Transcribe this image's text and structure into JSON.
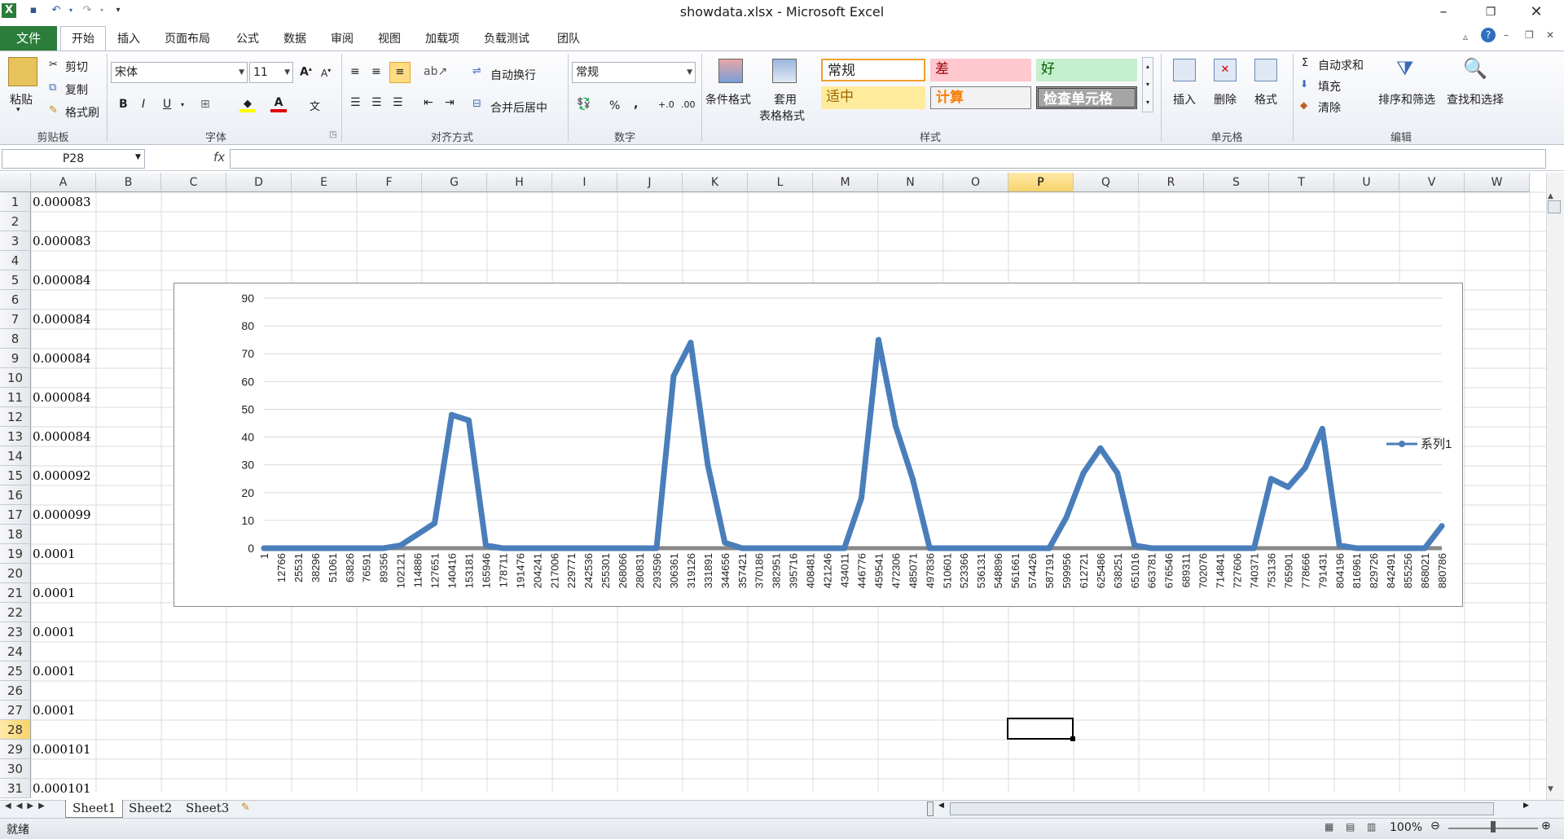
{
  "window": {
    "title": "showdata.xlsx - Microsoft Excel"
  },
  "tabs": {
    "file": "文件",
    "items": [
      "开始",
      "插入",
      "页面布局",
      "公式",
      "数据",
      "审阅",
      "视图",
      "加载项",
      "负载测试",
      "团队"
    ]
  },
  "ribbon": {
    "clipboard": {
      "paste": "粘贴",
      "cut": "剪切",
      "copy": "复制",
      "format_painter": "格式刷",
      "group": "剪贴板"
    },
    "font": {
      "name": "宋体",
      "size": "11",
      "bold": "B",
      "italic": "I",
      "underline": "U",
      "group": "字体"
    },
    "alignment": {
      "wrap": "自动换行",
      "merge": "合并后居中",
      "group": "对齐方式"
    },
    "number": {
      "format": "常规",
      "percent": "%",
      "comma": ",",
      "group": "数字"
    },
    "styles": {
      "cond_format": "条件格式",
      "table_format_1": "套用",
      "table_format_2": "表格格式",
      "normal": "常规",
      "bad": "差",
      "good": "好",
      "neutral": "适中",
      "calc": "计算",
      "check": "检查单元格",
      "group": "样式"
    },
    "cells": {
      "insert": "插入",
      "delete": "删除",
      "format": "格式",
      "group": "单元格"
    },
    "editing": {
      "autosum": "自动求和",
      "fill": "填充",
      "clear": "清除",
      "sort": "排序和筛选",
      "find": "查找和选择",
      "group": "编辑"
    }
  },
  "formula_bar": {
    "name_box": "P28",
    "fx": "fx",
    "value": ""
  },
  "columns": [
    "A",
    "B",
    "C",
    "D",
    "E",
    "F",
    "G",
    "H",
    "I",
    "J",
    "K",
    "L",
    "M",
    "N",
    "O",
    "P",
    "Q",
    "R",
    "S",
    "T",
    "U",
    "V",
    "W"
  ],
  "selected_column": "P",
  "selected_row": 28,
  "rows": [
    "1",
    "2",
    "3",
    "4",
    "5",
    "6",
    "7",
    "8",
    "9",
    "10",
    "11",
    "12",
    "13",
    "14",
    "15",
    "16",
    "17",
    "18",
    "19",
    "20",
    "21",
    "22",
    "23",
    "24",
    "25",
    "26",
    "27",
    "28",
    "29",
    "30",
    "31"
  ],
  "colA": [
    "0.000083",
    "",
    "0.000083",
    "",
    "0.000084",
    "",
    "0.000084",
    "",
    "0.000084",
    "",
    "0.000084",
    "",
    "0.000084",
    "",
    "0.000092",
    "",
    "0.000099",
    "",
    "0.0001",
    "",
    "0.0001",
    "",
    "0.0001",
    "",
    "0.0001",
    "",
    "0.0001",
    "",
    "0.000101",
    "",
    "0.000101"
  ],
  "chart_data": {
    "type": "line",
    "ylim": [
      0,
      90
    ],
    "yticks": [
      "0",
      "10",
      "20",
      "30",
      "40",
      "50",
      "60",
      "70",
      "80",
      "90"
    ],
    "categories": [
      "1",
      "12766",
      "25531",
      "38296",
      "51061",
      "63826",
      "76591",
      "89356",
      "102121",
      "114886",
      "127651",
      "140416",
      "153181",
      "165946",
      "178711",
      "191476",
      "204241",
      "217006",
      "229771",
      "242536",
      "255301",
      "268066",
      "280831",
      "293596",
      "306361",
      "319126",
      "331891",
      "344656",
      "357421",
      "370186",
      "382951",
      "395716",
      "408481",
      "421246",
      "434011",
      "446776",
      "459541",
      "472306",
      "485071",
      "497836",
      "510601",
      "523366",
      "536131",
      "548896",
      "561661",
      "574426",
      "587191",
      "599956",
      "612721",
      "625486",
      "638251",
      "651016",
      "663781",
      "676546",
      "689311",
      "702076",
      "714841",
      "727606",
      "740371",
      "753136",
      "765901",
      "778666",
      "791431",
      "804196",
      "816961",
      "829726",
      "842491",
      "855256",
      "868021",
      "880786"
    ],
    "series": [
      {
        "name": "系列1",
        "color": "#4a7ebb",
        "values": [
          0,
          0,
          0,
          0,
          0,
          0,
          0,
          0,
          1,
          5,
          9,
          48,
          46,
          1,
          0,
          0,
          0,
          0,
          0,
          0,
          0,
          0,
          0,
          0,
          62,
          74,
          30,
          2,
          0,
          0,
          0,
          0,
          0,
          0,
          0,
          18,
          75,
          44,
          25,
          0,
          0,
          0,
          0,
          0,
          0,
          0,
          0,
          11,
          27,
          36,
          27,
          1,
          0,
          0,
          0,
          0,
          0,
          0,
          0,
          25,
          22,
          29,
          43,
          1,
          0,
          0,
          0,
          0,
          0,
          8
        ]
      }
    ]
  },
  "sheets": [
    "Sheet1",
    "Sheet2",
    "Sheet3"
  ],
  "status": {
    "ready": "就绪",
    "zoom": "100%"
  }
}
